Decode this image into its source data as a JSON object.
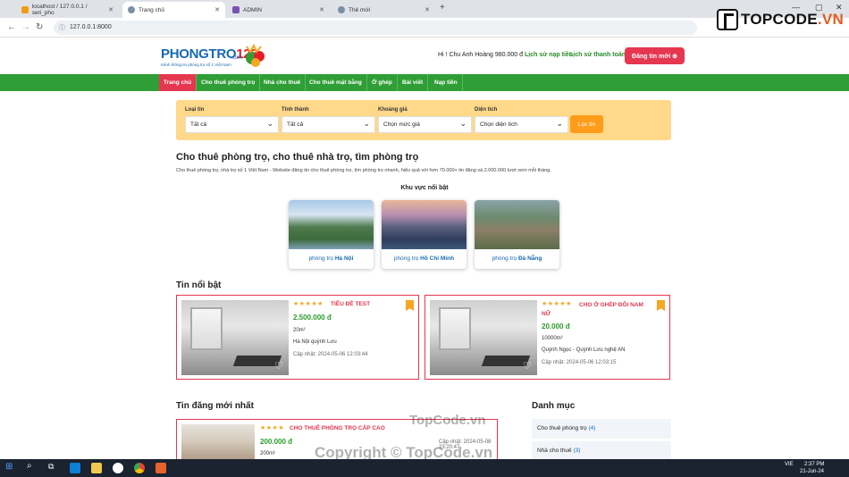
{
  "browser": {
    "tabs": [
      {
        "label": "localhost / 127.0.0.1 / seri_pho",
        "active": false
      },
      {
        "label": "Trang chủ",
        "active": true
      },
      {
        "label": "ADMIN",
        "active": false
      },
      {
        "label": "Thẻ mới",
        "active": false
      }
    ],
    "url": "127.0.0.1:8000"
  },
  "brand_watermark": {
    "main": "TOPCODE",
    "suffix": ".VN"
  },
  "header": {
    "logo_text": "PHONGTRO",
    "logo_number": "123",
    "logo_com": ".com",
    "logo_tagline": "Kênh thông tin phòng trọ số 1 Việt Nam",
    "greeting": "Hi ! Chu Anh Hoàng 980.000 đ",
    "topup_history": "Lịch sử nạp tiền",
    "payment_history": "Lịch sử thanh toán",
    "post_button": "Đăng tin mới ⊕"
  },
  "menu": [
    "Trang chủ",
    "Cho thuê phòng trọ",
    "Nhà cho thuê",
    "Cho thuê mặt bằng",
    "Ở ghép",
    "Bài viết",
    "Nạp tiền"
  ],
  "filters": {
    "type_label": "Loại tin",
    "type_value": "Tất cả",
    "province_label": "Tỉnh thành",
    "province_value": "Tất cả",
    "price_label": "Khoảng giá",
    "price_value": "Chọn mức giá",
    "area_label": "Diện tích",
    "area_value": "Chọn diện tích",
    "filter_button": "Lọc tin"
  },
  "intro": {
    "title": "Cho thuê phòng trọ, cho thuê nhà trọ, tìm phòng trọ",
    "description": "Cho thuê phòng trọ, nhà trọ số 1 Việt Nam - Website đăng tin cho thuê phòng trọ, tìm phòng trọ nhanh, hiệu quả với hơn 70.000+ tin đăng và 2.000.000 lượt xem mỗi tháng."
  },
  "areas": {
    "title": "Khu vực nổi bật",
    "prefix": "phòng trọ",
    "items": [
      "Hà Nội",
      "Hồ Chí Minh",
      "Đà Nẵng"
    ]
  },
  "featured": {
    "title": "Tin nổi bật",
    "stars": "★★★★★",
    "items": [
      {
        "title": "TIÊU ĐỀ TEST",
        "price": "2.500.000 đ",
        "size": "20m²",
        "address": "Hà Nội quỳnh Lưu",
        "updated": "Cập nhật: 2024-05-06 12:03:44"
      },
      {
        "title": "CHO Ở GHÉP ĐÔI NAM NỮ",
        "price": "20.000 đ",
        "size": "10000m²",
        "address": "Quỳnh Ngọc - Quỳnh Lưu nghệ AN",
        "updated": "Cập nhật: 2024-05-06 12:03:15"
      }
    ]
  },
  "latest": {
    "title": "Tin đăng mới nhất",
    "stars": "★★★★",
    "item": {
      "title": "CHO THUÊ PHÒNG TRỌ CẤP CAO",
      "price": "200.000 đ",
      "size": "200m²",
      "updated": "Cập nhật: 2024-05-08 23:20:47"
    }
  },
  "categories": {
    "title": "Danh mục",
    "items": [
      {
        "label": "Cho thuê phòng trọ",
        "count": "(4)"
      },
      {
        "label": "Nhà cho thuê",
        "count": "(3)"
      }
    ]
  },
  "watermarks": {
    "top": "TopCode.vn",
    "bottom": "Copyright © TopCode.vn"
  },
  "taskbar": {
    "lang": "VIE",
    "time": "2:37 PM",
    "date": "21-Jun-24"
  }
}
